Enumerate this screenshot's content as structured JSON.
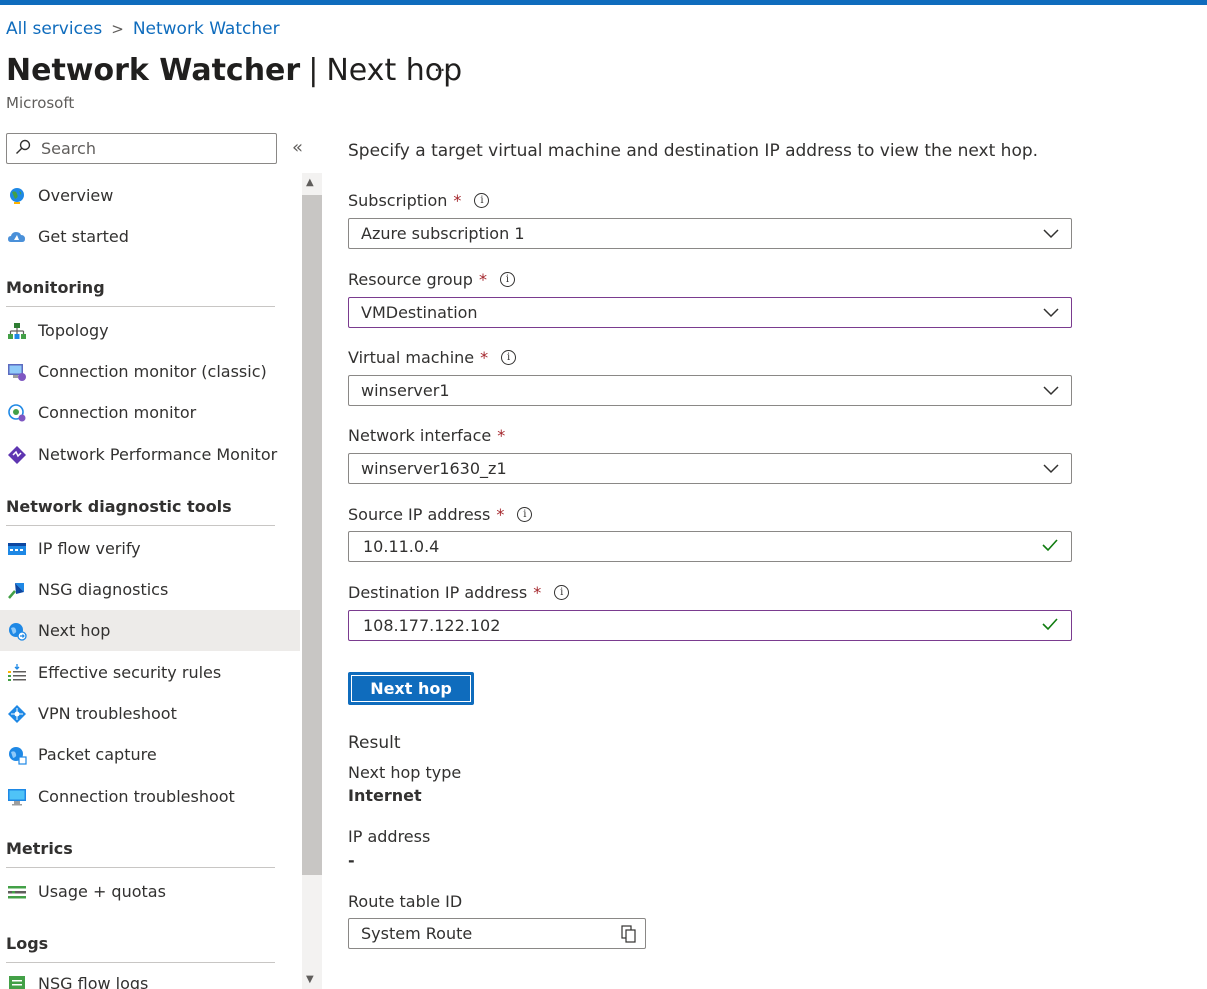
{
  "breadcrumb": {
    "item1": "All services",
    "separator": ">",
    "item2": "Network Watcher"
  },
  "header": {
    "title_main": "Network Watcher",
    "title_separator": "|",
    "title_page": "Next hop",
    "more": "···",
    "subtitle": "Microsoft"
  },
  "sidebar": {
    "search_placeholder": "Search",
    "collapse": "«",
    "items": {
      "overview": "Overview",
      "get_started": "Get started",
      "topology": "Topology",
      "conn_monitor_classic": "Connection monitor (classic)",
      "conn_monitor": "Connection monitor",
      "npm": "Network Performance Monitor",
      "ip_flow": "IP flow verify",
      "nsg_diag": "NSG diagnostics",
      "next_hop": "Next hop",
      "eff_security": "Effective security rules",
      "vpn": "VPN troubleshoot",
      "packet": "Packet capture",
      "conn_troubleshoot": "Connection troubleshoot",
      "usage": "Usage + quotas",
      "nsg_flow_logs": "NSG flow logs"
    },
    "sections": {
      "monitoring": "Monitoring",
      "diag_tools": "Network diagnostic tools",
      "metrics": "Metrics",
      "logs": "Logs"
    },
    "selected": "Next hop"
  },
  "form": {
    "intro": "Specify a target virtual machine and destination IP address to view the next hop.",
    "required_mark": "*",
    "info_glyph": "i",
    "subscription": {
      "label": "Subscription",
      "value": "Azure subscription 1"
    },
    "resource_group": {
      "label": "Resource group",
      "value": "VMDestination"
    },
    "virtual_machine": {
      "label": "Virtual machine",
      "value": "winserver1"
    },
    "network_interface": {
      "label": "Network interface",
      "value": "winserver1630_z1"
    },
    "source_ip": {
      "label": "Source IP address",
      "value": "10.11.0.4"
    },
    "destination_ip": {
      "label": "Destination IP address",
      "value": "108.177.122.102"
    },
    "button": "Next hop"
  },
  "result": {
    "heading": "Result",
    "next_hop_type_label": "Next hop type",
    "next_hop_type_value": "Internet",
    "ip_address_label": "IP address",
    "ip_address_value": "-",
    "route_table_label": "Route table ID",
    "route_table_value": "System Route"
  },
  "colors": {
    "accent": "#0f6cbd",
    "focus_border": "#7a3b8f",
    "success": "#107c10",
    "required": "#a4262c"
  }
}
